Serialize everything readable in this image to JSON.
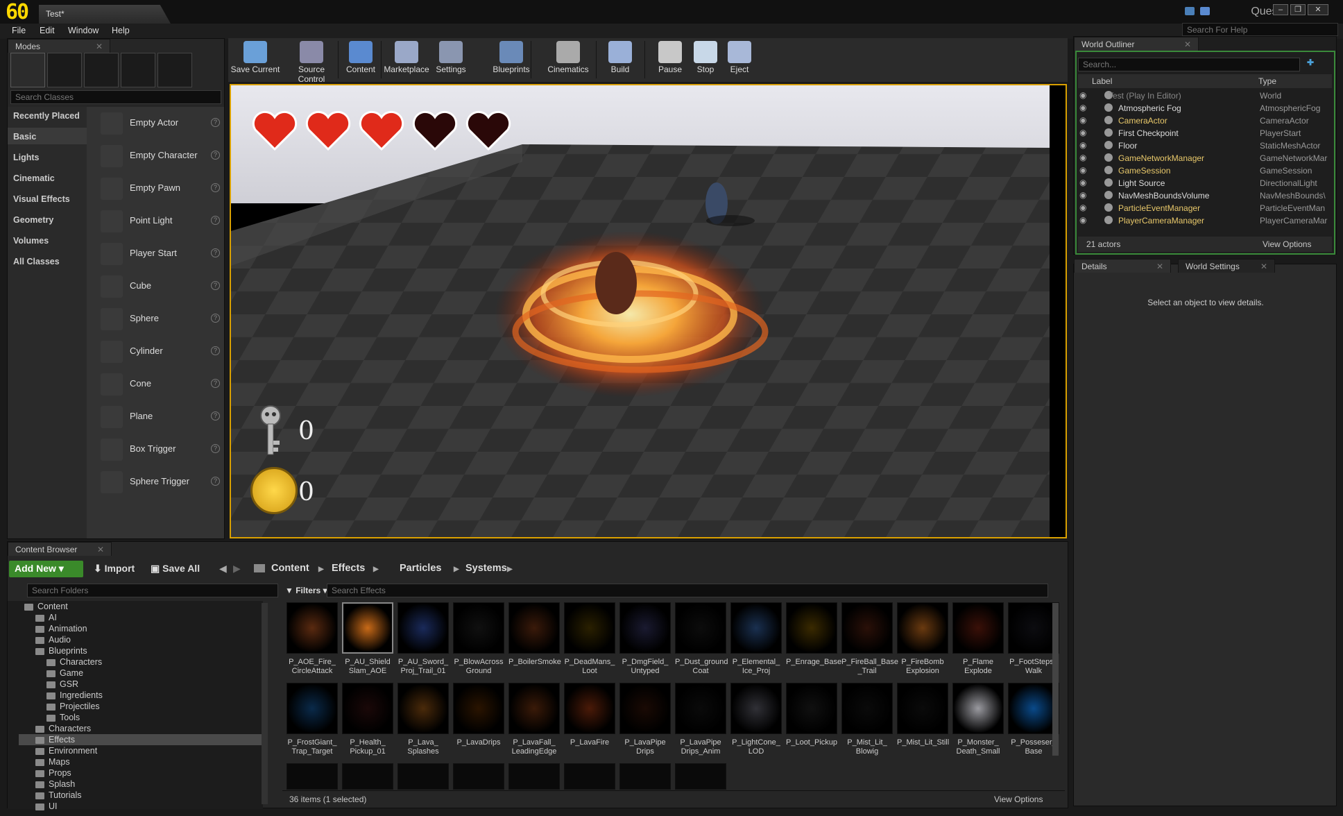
{
  "app": {
    "fps": "60",
    "tab_title": "Test*",
    "quest": "Quest"
  },
  "menu": [
    "File",
    "Edit",
    "Window",
    "Help"
  ],
  "help_search_placeholder": "Search For Help",
  "modes": {
    "title": "Modes",
    "search_placeholder": "Search Classes",
    "categories": [
      "Recently Placed",
      "Basic",
      "Lights",
      "Cinematic",
      "Visual Effects",
      "Geometry",
      "Volumes",
      "All Classes"
    ],
    "selected_category": "Basic",
    "actors": [
      "Empty Actor",
      "Empty Character",
      "Empty Pawn",
      "Point Light",
      "Player Start",
      "Cube",
      "Sphere",
      "Cylinder",
      "Cone",
      "Plane",
      "Box Trigger",
      "Sphere Trigger"
    ]
  },
  "toolbar": [
    "Save Current",
    "Source Control",
    "Content",
    "Marketplace",
    "Settings",
    "Blueprints",
    "Cinematics",
    "Build",
    "Pause",
    "Stop",
    "Eject"
  ],
  "hud": {
    "hearts_full": 3,
    "hearts_empty": 2,
    "keys": "0",
    "coins": "0"
  },
  "outliner": {
    "title": "World Outliner",
    "search_placeholder": "Search...",
    "col_label": "Label",
    "col_type": "Type",
    "rows": [
      {
        "label": "Test (Play In Editor)",
        "type": "World",
        "color": "#888888"
      },
      {
        "label": "Atmospheric Fog",
        "type": "AtmosphericFog",
        "color": "#dddddd"
      },
      {
        "label": "CameraActor",
        "type": "CameraActor",
        "color": "#e8c86a"
      },
      {
        "label": "First Checkpoint",
        "type": "PlayerStart",
        "color": "#dddddd"
      },
      {
        "label": "Floor",
        "type": "StaticMeshActor",
        "color": "#dddddd"
      },
      {
        "label": "GameNetworkManager",
        "type": "GameNetworkMar",
        "color": "#e8c86a"
      },
      {
        "label": "GameSession",
        "type": "GameSession",
        "color": "#e8c86a"
      },
      {
        "label": "Light Source",
        "type": "DirectionalLight",
        "color": "#dddddd"
      },
      {
        "label": "NavMeshBoundsVolume",
        "type": "NavMeshBounds\\",
        "color": "#dddddd"
      },
      {
        "label": "ParticleEventManager",
        "type": "ParticleEventMan",
        "color": "#e8c86a"
      },
      {
        "label": "PlayerCameraManager",
        "type": "PlayerCameraMar",
        "color": "#e8c86a"
      }
    ],
    "count": "21 actors",
    "view_options": "View Options"
  },
  "details": {
    "tab1": "Details",
    "tab2": "World Settings",
    "message": "Select an object to view details."
  },
  "content_browser": {
    "title": "Content Browser",
    "add_new": "Add New",
    "import": "Import",
    "save_all": "Save All",
    "breadcrumb": [
      "Content",
      "Effects",
      "Particles",
      "Systems"
    ],
    "search_folders": "Search Folders",
    "filters": "Filters",
    "search_effects": "Search Effects",
    "folders": [
      {
        "name": "Content",
        "indent": 0
      },
      {
        "name": "AI",
        "indent": 1
      },
      {
        "name": "Animation",
        "indent": 1
      },
      {
        "name": "Audio",
        "indent": 1
      },
      {
        "name": "Blueprints",
        "indent": 1
      },
      {
        "name": "Characters",
        "indent": 2
      },
      {
        "name": "Game",
        "indent": 2
      },
      {
        "name": "GSR",
        "indent": 2
      },
      {
        "name": "Ingredients",
        "indent": 2
      },
      {
        "name": "Projectiles",
        "indent": 2
      },
      {
        "name": "Tools",
        "indent": 2
      },
      {
        "name": "Characters",
        "indent": 1
      },
      {
        "name": "Effects",
        "indent": 1
      },
      {
        "name": "Environment",
        "indent": 1
      },
      {
        "name": "Maps",
        "indent": 1
      },
      {
        "name": "Props",
        "indent": 1
      },
      {
        "name": "Splash",
        "indent": 1
      },
      {
        "name": "Tutorials",
        "indent": 1
      },
      {
        "name": "UI",
        "indent": 1
      }
    ],
    "assets_row1": [
      "P_AOE_Fire_ CircleAttack",
      "P_AU_Shield Slam_AOE",
      "P_AU_Sword_ Proj_Trail_01",
      "P_BlowAcross Ground",
      "P_BoilerSmoke",
      "P_DeadMans_ Loot",
      "P_DmgField_ Untyped",
      "P_Dust_ground Coat",
      "P_Elemental_ Ice_Proj",
      "P_Enrage_Base",
      "P_FireBall_Base _Trail",
      "P_FireBomb Explosion",
      "P_Flame Explode",
      "P_FootSteps_ Walk"
    ],
    "assets_row2": [
      "P_FrostGiant_ Trap_Target",
      "P_Health_ Pickup_01",
      "P_Lava_ Splashes",
      "P_LavaDrips",
      "P_LavaFall_ LeadingEdge",
      "P_LavaFire",
      "P_LavaPipe Drips",
      "P_LavaPipe Drips_Anim",
      "P_LightCone_ LOD",
      "P_Loot_Pickup",
      "P_Mist_Lit_ Blowig",
      "P_Mist_Lit_Still",
      "P_Monster_ Death_Small",
      "P_Posseser_ Base"
    ],
    "status": "36 items (1 selected)",
    "view_options": "View Options"
  }
}
